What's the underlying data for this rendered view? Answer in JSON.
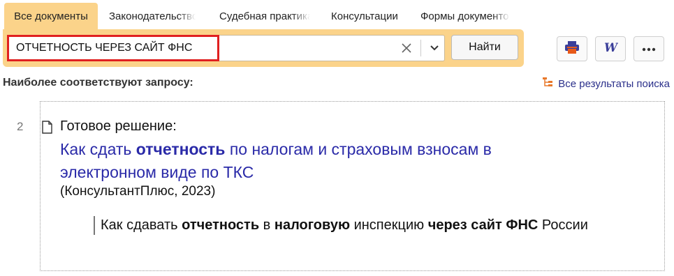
{
  "tabs": [
    {
      "label": "Все документы"
    },
    {
      "label": "Законодательство"
    },
    {
      "label": "Судебная практика"
    },
    {
      "label": "Консультации"
    },
    {
      "label": "Формы документов"
    }
  ],
  "search": {
    "query": "ОТЧЕТНОСТЬ ЧЕРЕЗ САЙТ ФНС",
    "find_label": "Найти"
  },
  "toolbar": {
    "print_icon": "printer-icon",
    "word_icon": "word-export-icon",
    "more_icon": "more-icon"
  },
  "results": {
    "heading": "Наиболее соответствуют запросу:",
    "all_results_label": "Все результаты поиска",
    "item": {
      "number": "2",
      "doc_type": "Готовое решение:",
      "title_parts": [
        "Как сдать ",
        "отчетность",
        " по налогам и страховым взносам в электронном виде по ТКС"
      ],
      "source": "(КонсультантПлюс, 2023)",
      "snippet_parts": [
        "Как сдавать ",
        "отчетность",
        " в ",
        "налоговую",
        " инспекцию ",
        "через сайт ФНС",
        " России"
      ]
    }
  },
  "colors": {
    "accent": "#fbd38a",
    "highlight_border": "#e02020",
    "link": "#2a2aa8"
  }
}
